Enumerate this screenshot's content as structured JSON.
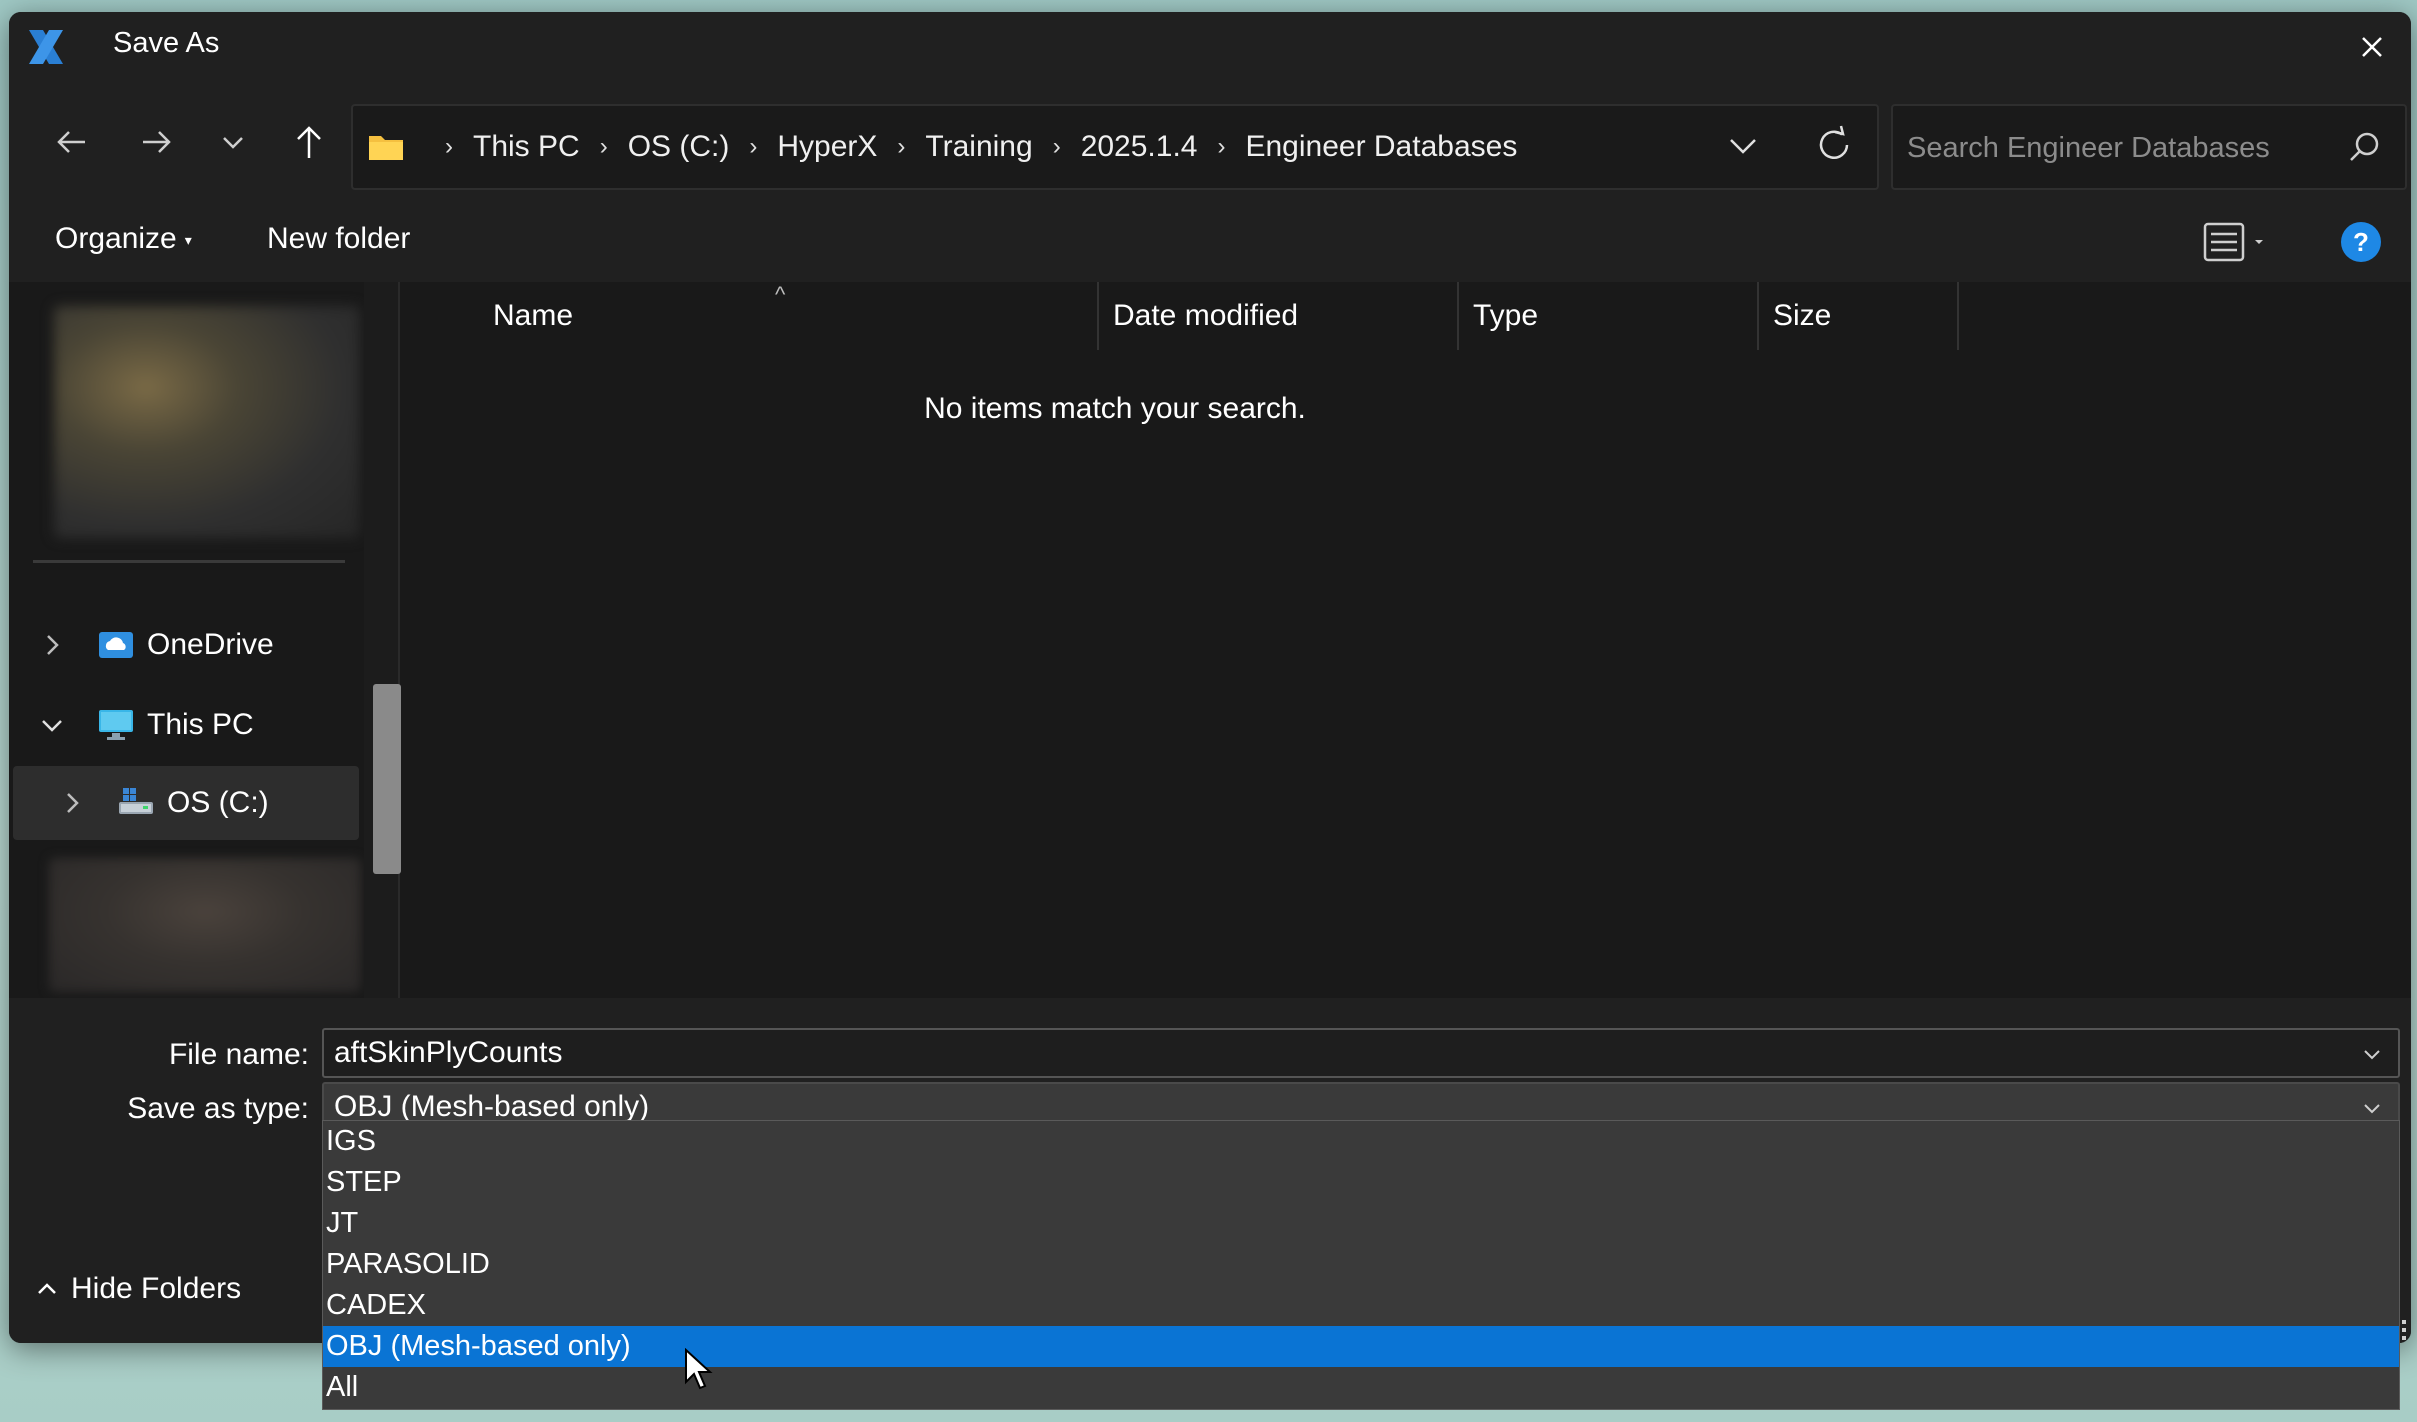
{
  "window": {
    "title": "Save As",
    "accent": "#0a74d4"
  },
  "address": {
    "crumbs": [
      "This PC",
      "OS (C:)",
      "HyperX",
      "Training",
      "2025.1.4",
      "Engineer Databases"
    ]
  },
  "search": {
    "placeholder": "Search Engineer Databases"
  },
  "toolbar": {
    "organize_label": "Organize",
    "new_folder_label": "New folder"
  },
  "nav_pane": {
    "items": [
      {
        "label": "OneDrive",
        "icon": "onedrive-cloud-icon",
        "expanded": false
      },
      {
        "label": "This PC",
        "icon": "monitor-icon",
        "expanded": true
      },
      {
        "label": "OS (C:)",
        "icon": "drive-icon",
        "expanded": false,
        "selected": true
      }
    ]
  },
  "columns": [
    "Name",
    "Date modified",
    "Type",
    "Size"
  ],
  "empty_message": "No items match your search.",
  "form": {
    "file_name_label": "File name:",
    "file_name_value": "aftSkinPlyCounts",
    "save_type_label": "Save as type:",
    "save_type_value": "OBJ (Mesh-based only)"
  },
  "dropdown": {
    "options": [
      "IGS",
      "STEP",
      "JT",
      "PARASOLID",
      "CADEX",
      "OBJ (Mesh-based only)",
      "All"
    ],
    "selected_index": 5
  },
  "hide_folders_label": "Hide Folders"
}
